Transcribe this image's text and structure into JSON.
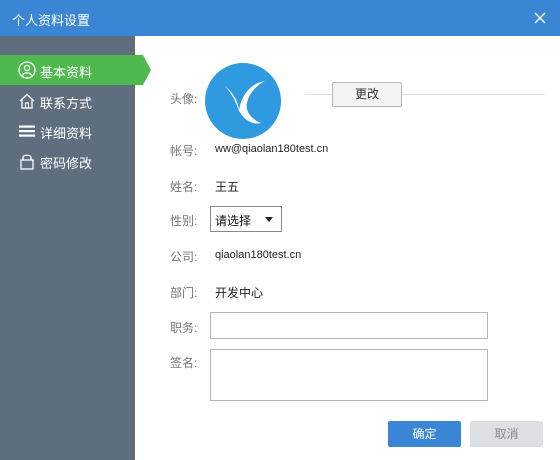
{
  "window": {
    "title": "个人资料设置",
    "close_icon": "close-icon"
  },
  "sidebar": {
    "items": [
      {
        "label": "基本资料",
        "icon": "user-circle-icon",
        "active": true
      },
      {
        "label": "联系方式",
        "icon": "home-icon",
        "active": false
      },
      {
        "label": "详细资料",
        "icon": "list-icon",
        "active": false
      },
      {
        "label": "密码修改",
        "icon": "lock-icon",
        "active": false
      }
    ]
  },
  "form": {
    "avatar_label": "头像:",
    "change_avatar_label": "更改",
    "account_label": "帐号:",
    "account_value": "ww@qiaolan180test.cn",
    "name_label": "姓名:",
    "name_value": "王五",
    "gender_label": "性别:",
    "gender_selected": "请选择",
    "company_label": "公司:",
    "company_value": "qiaolan180test.cn",
    "department_label": "部门:",
    "department_value": "开发中心",
    "title_label": "职务:",
    "title_value": "",
    "signature_label": "签名:",
    "signature_value": ""
  },
  "footer": {
    "ok_label": "确定",
    "cancel_label": "取消"
  },
  "colors": {
    "accent": "#3a86d4",
    "sidebar": "#5f6e7e",
    "active": "#4fb84f"
  }
}
